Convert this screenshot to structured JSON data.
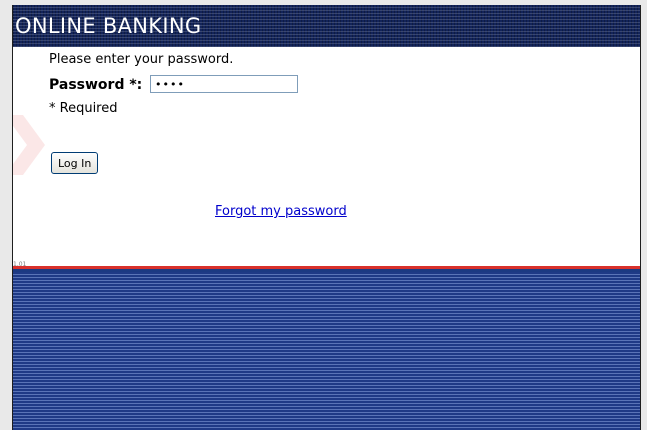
{
  "header": {
    "title": "ONLINE BANKING"
  },
  "login": {
    "instruction": "Please enter your password.",
    "password_label": "Password *:",
    "password_value": "mask",
    "required_note": "* Required",
    "login_button_label": "Log In",
    "forgot_link_label": "Forgot my password"
  },
  "footer": {
    "version_text": "1.01"
  },
  "colors": {
    "header_bg": "#13245a",
    "accent_red": "#d9312c",
    "link": "#0000cc",
    "footer_bg": "#24408e"
  }
}
